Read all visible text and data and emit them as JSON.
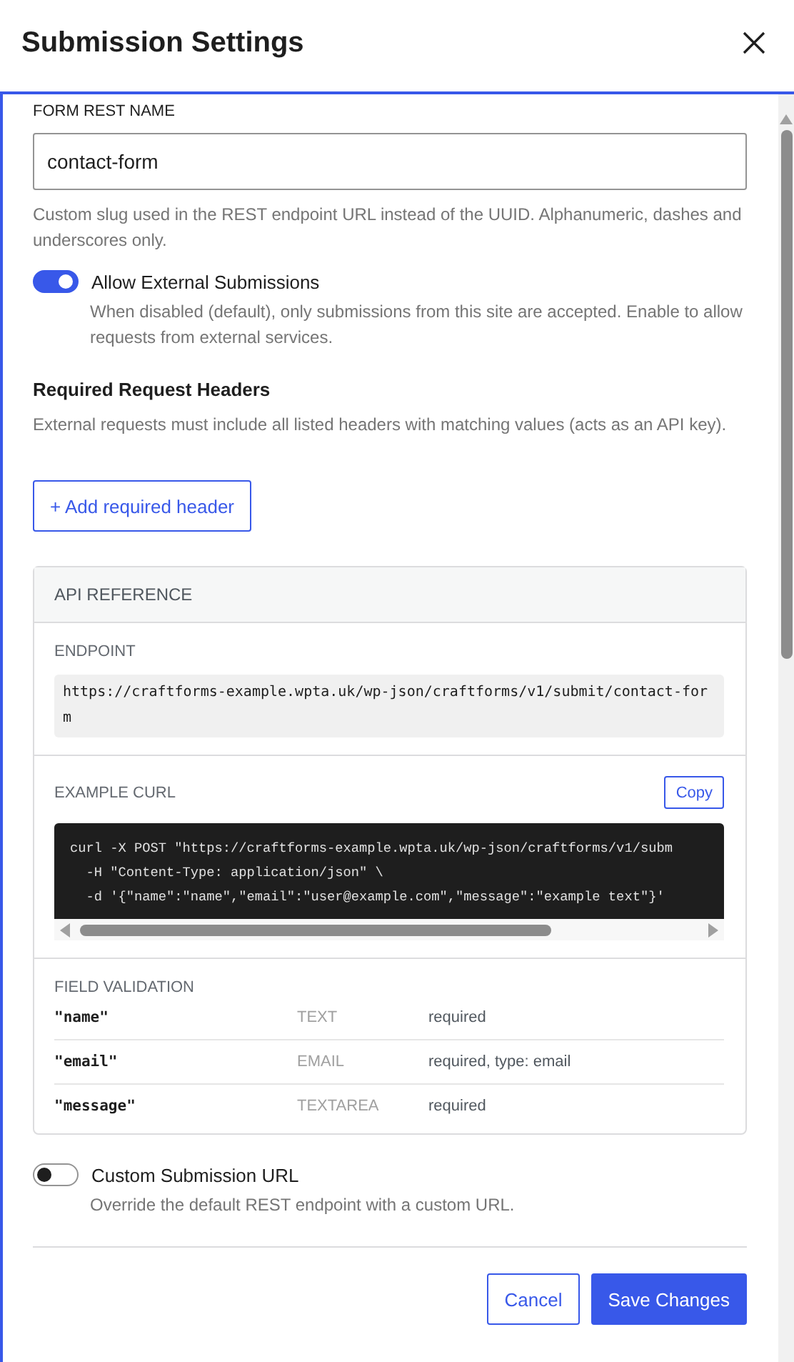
{
  "dialog": {
    "title": "Submission Settings"
  },
  "rest_name": {
    "label": "FORM REST NAME",
    "value": "contact-form",
    "help": "Custom slug used in the REST endpoint URL instead of the UUID. Alphanumeric, dashes and underscores only."
  },
  "external_submissions": {
    "label": "Allow External Submissions",
    "on": true,
    "description": "When disabled (default), only submissions from this site are accepted. Enable to allow requests from external services."
  },
  "required_headers": {
    "title": "Required Request Headers",
    "description": "External requests must include all listed headers with matching values (acts as an API key).",
    "add_button": "+ Add required header"
  },
  "api_reference": {
    "title": "API REFERENCE",
    "endpoint": {
      "label": "ENDPOINT",
      "url": "https://craftforms-example.wpta.uk/wp-json/craftforms/v1/submit/contact-form"
    },
    "example_curl": {
      "label": "EXAMPLE CURL",
      "copy_button": "Copy",
      "lines": [
        "curl -X POST \"https://craftforms-example.wpta.uk/wp-json/craftforms/v1/subm",
        "  -H \"Content-Type: application/json\" \\",
        "  -d '{\"name\":\"name\",\"email\":\"user@example.com\",\"message\":\"example text\"}'"
      ]
    },
    "field_validation": {
      "label": "FIELD VALIDATION",
      "rows": [
        {
          "field": "\"name\"",
          "type": "TEXT",
          "rules": "required"
        },
        {
          "field": "\"email\"",
          "type": "EMAIL",
          "rules": "required, type: email"
        },
        {
          "field": "\"message\"",
          "type": "TEXTAREA",
          "rules": "required"
        }
      ]
    }
  },
  "custom_url": {
    "label": "Custom Submission URL",
    "on": false,
    "description": "Override the default REST endpoint with a custom URL."
  },
  "footer": {
    "cancel": "Cancel",
    "save": "Save Changes"
  }
}
